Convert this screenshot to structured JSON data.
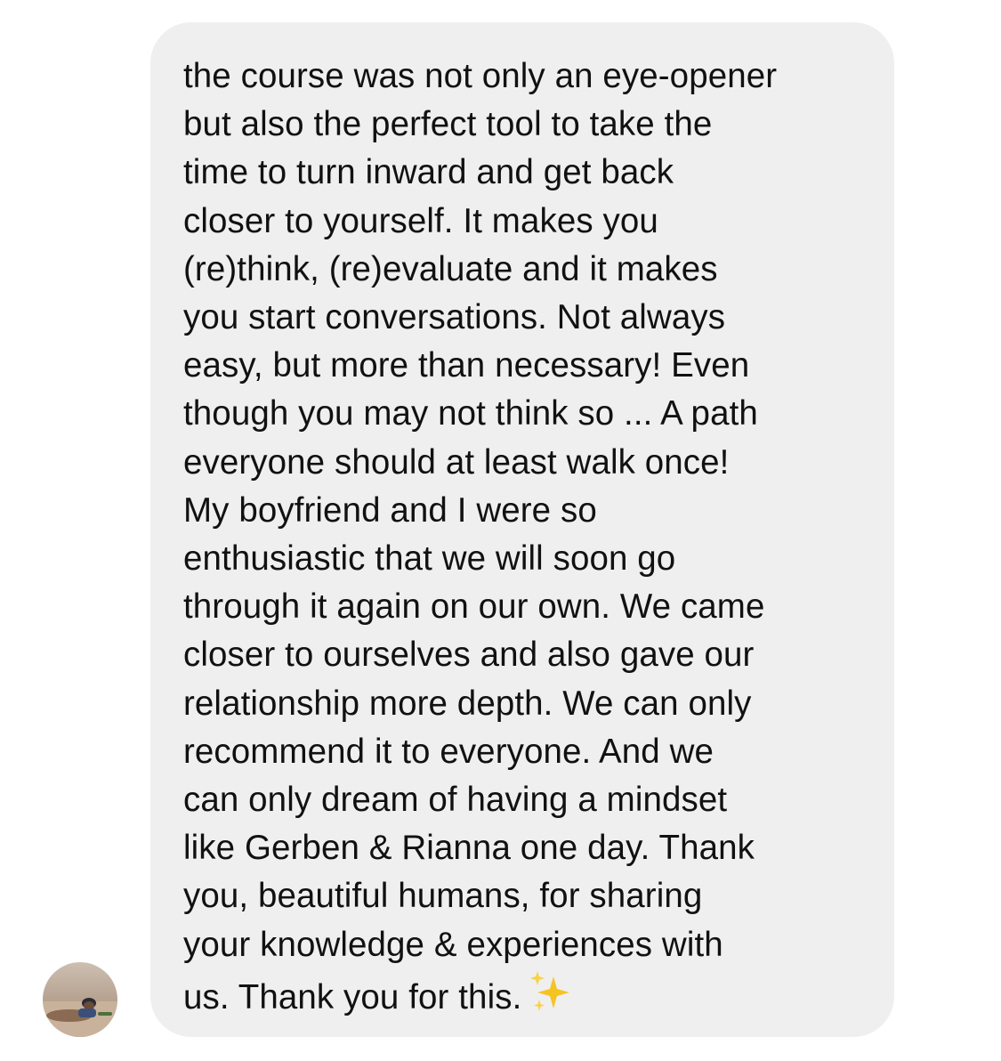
{
  "message": {
    "lines": [
      "the course was not only an eye-opener",
      "but also the perfect tool to take the",
      "time to turn inward and get back",
      "closer to yourself. It makes you",
      "(re)think, (re)evaluate and it makes",
      "you start conversations. Not always",
      "easy, but more than necessary! Even",
      "though you may not think so ... A path",
      "everyone should at least walk once!",
      "My boyfriend and I were so",
      "enthusiastic that we will soon go",
      "through it again on our own. We came",
      "closer to ourselves and also gave our",
      "relationship more depth. We can only",
      "recommend it to everyone. And we",
      "can only dream of having a mindset",
      "like Gerben & Rianna one day. Thank",
      "you, beautiful humans, for sharing",
      "your knowledge & experiences with",
      "us. Thank you for this."
    ],
    "emoji": "sparkles-icon"
  },
  "sender": {
    "avatar": "avatar-photo"
  },
  "colors": {
    "bubble": "#efefef",
    "text": "#111111",
    "sparkle": "#f5c423"
  }
}
